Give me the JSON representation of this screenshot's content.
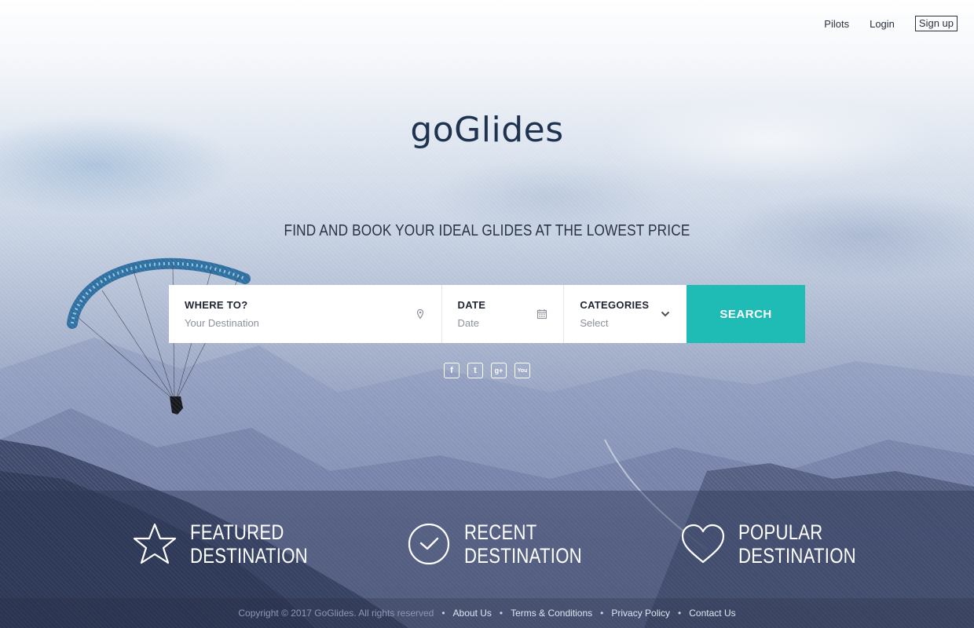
{
  "nav": {
    "pilots": "Pilots",
    "login": "Login",
    "signup": "Sign up"
  },
  "brand": {
    "logo": "goGlides"
  },
  "hero": {
    "tagline": "FIND AND BOOK YOUR IDEAL GLIDES AT THE LOWEST PRICE"
  },
  "search": {
    "where_label": "WHERE TO?",
    "where_placeholder": "Your Destination",
    "date_label": "DATE",
    "date_placeholder": "Date",
    "category_label": "CATEGORIES",
    "category_value": "Select",
    "button": "SEARCH"
  },
  "social": [
    {
      "icon": "facebook-icon",
      "glyph": "f"
    },
    {
      "icon": "twitter-icon",
      "glyph": "t"
    },
    {
      "icon": "google-plus-icon",
      "glyph": "g+"
    },
    {
      "icon": "youtube-icon",
      "glyph": "You"
    }
  ],
  "features": [
    {
      "line1": "FEATURED",
      "line2": "DESTINATION",
      "icon": "star-icon"
    },
    {
      "line1": "RECENT",
      "line2": "DESTINATION",
      "icon": "clock-check-icon"
    },
    {
      "line1": "POPULAR",
      "line2": "DESTINATION",
      "icon": "heart-icon"
    }
  ],
  "footer": {
    "copyright": "Copyright © 2017 GoGlides. All rights reserved",
    "sep": "•",
    "links": [
      "About Us",
      "Terms & Conditions",
      "Privacy Policy",
      "Contact Us"
    ]
  },
  "colors": {
    "accent": "#1fbcb6",
    "logo": "#1f3350",
    "text_dark": "#1f2430"
  }
}
